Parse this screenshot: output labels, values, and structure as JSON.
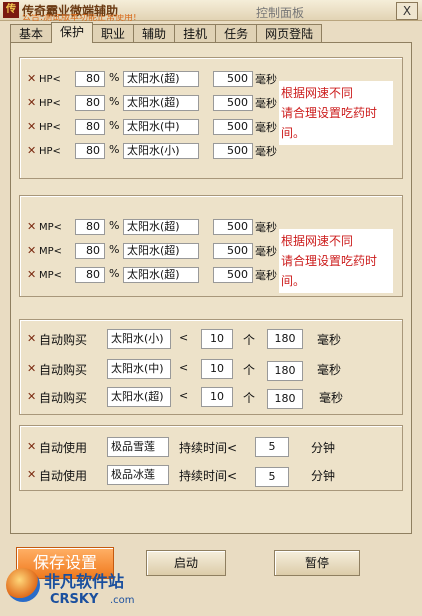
{
  "window": {
    "app_name": "传奇霸业微端辅助",
    "ticker": "公告:测试版本功能正常使用!",
    "title": "控制面板",
    "close_label": "X"
  },
  "tabs": [
    "基本",
    "保护",
    "职业",
    "辅助",
    "挂机",
    "任务",
    "网页登陆"
  ],
  "hp_rows": [
    {
      "label": "HP<",
      "value": "80",
      "pct": "%",
      "potion": "太阳水(超)",
      "ms": "500",
      "unit": "毫秒"
    },
    {
      "label": "HP<",
      "value": "80",
      "pct": "%",
      "potion": "太阳水(超)",
      "ms": "500",
      "unit": "毫秒"
    },
    {
      "label": "HP<",
      "value": "80",
      "pct": "%",
      "potion": "太阳水(中)",
      "ms": "500",
      "unit": "毫秒"
    },
    {
      "label": "HP<",
      "value": "80",
      "pct": "%",
      "potion": "太阳水(小)",
      "ms": "500",
      "unit": "毫秒"
    }
  ],
  "hp_hint": [
    "根据网速不同",
    "请合理设置吃药时",
    "间。"
  ],
  "mp_rows": [
    {
      "label": "MP<",
      "value": "80",
      "pct": "%",
      "potion": "太阳水(超)",
      "ms": "500",
      "unit": "毫秒"
    },
    {
      "label": "MP<",
      "value": "80",
      "pct": "%",
      "potion": "太阳水(超)",
      "ms": "500",
      "unit": "毫秒"
    },
    {
      "label": "MP<",
      "value": "80",
      "pct": "%",
      "potion": "太阳水(超)",
      "ms": "500",
      "unit": "毫秒"
    }
  ],
  "mp_hint": [
    "根据网速不同",
    "请合理设置吃药时",
    "间。"
  ],
  "buy_rows": [
    {
      "label": "自动购买",
      "potion": "太阳水(小)",
      "lt": "<",
      "count": "10",
      "count_unit": "个",
      "ms": "180",
      "unit": "毫秒"
    },
    {
      "label": "自动购买",
      "potion": "太阳水(中)",
      "lt": "<",
      "count": "10",
      "count_unit": "个",
      "ms": "180",
      "unit": "毫秒"
    },
    {
      "label": "自动购买",
      "potion": "太阳水(超)",
      "lt": "<",
      "count": "10",
      "count_unit": "个",
      "ms": "180",
      "unit": "毫秒"
    }
  ],
  "use_rows": [
    {
      "label": "自动使用",
      "item": "极品雪莲",
      "dur_label": "持续时间<",
      "minutes": "5",
      "unit": "分钟"
    },
    {
      "label": "自动使用",
      "item": "极品冰莲",
      "dur_label": "持续时间<",
      "minutes": "5",
      "unit": "分钟"
    }
  ],
  "buttons": {
    "save": "保存设置",
    "start": "启动",
    "pause": "暂停"
  },
  "watermark": {
    "name": "非凡软件站",
    "sub": "CRSKY",
    "url": ".com"
  }
}
